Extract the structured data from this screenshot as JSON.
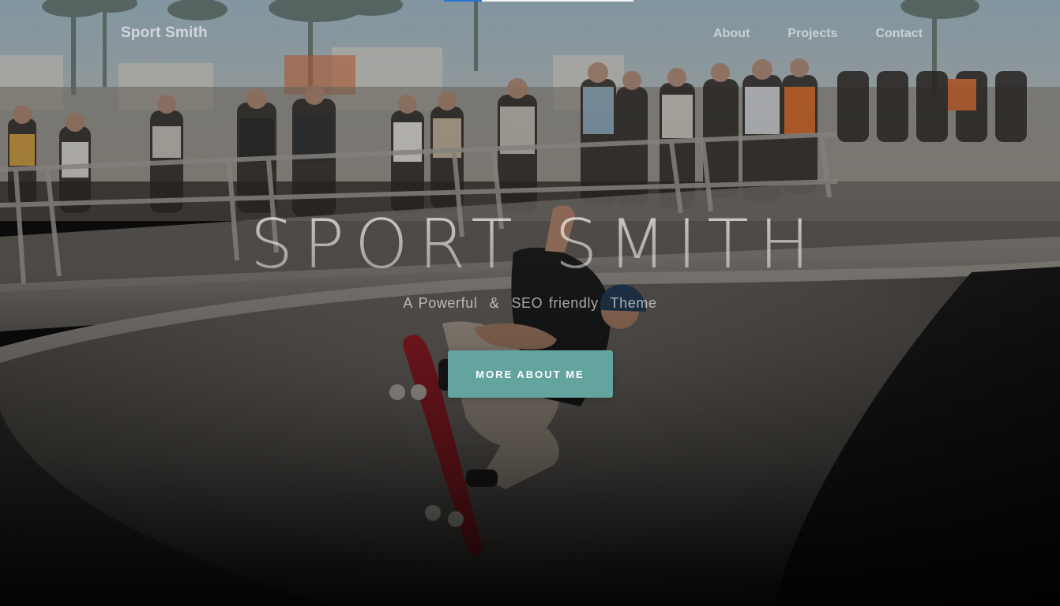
{
  "colors": {
    "accent": "#64a49f",
    "overlay": "#000000",
    "sky": "#9fb7c4",
    "concrete": "#5a5752",
    "bowl_shadow": "#151515"
  },
  "navbar": {
    "brand": "Sport Smith",
    "links": [
      {
        "label": "About"
      },
      {
        "label": "Projects"
      },
      {
        "label": "Contact"
      }
    ]
  },
  "hero": {
    "title": "SPORT SMITH",
    "subtitle": "A Powerful  &  SEO friendly  Theme",
    "cta_label": "More About Me",
    "background_photo": "skateboarder-in-bowl"
  }
}
